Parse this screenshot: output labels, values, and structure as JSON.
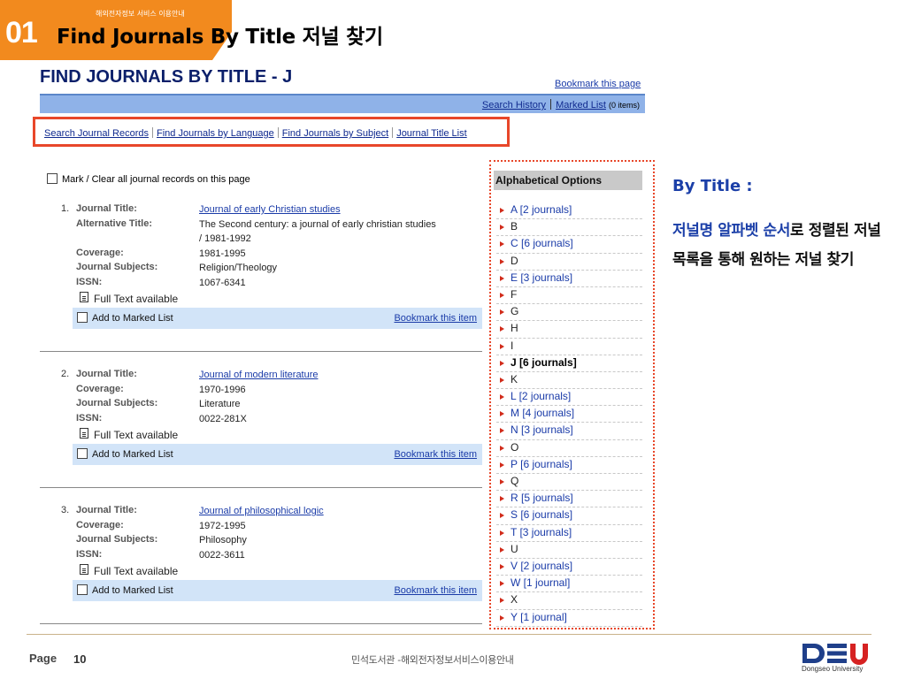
{
  "slide": {
    "section_number": "01",
    "section_subtitle": "해외전자정보 서비스 이용안내",
    "title": "Find Journals By Title 저널 찾기"
  },
  "screen": {
    "heading": "FIND JOURNALS BY TITLE - J",
    "bookmark_page": "Bookmark this page",
    "search_history": "Search History",
    "marked_list": "Marked List",
    "marked_count": "(0 items)",
    "nav_links": [
      "Search Journal Records",
      "Find Journals by Language",
      "Find Journals by Subject",
      "Journal Title List"
    ],
    "mark_all_label": "Mark / Clear all journal records on this page",
    "records": [
      {
        "num": "1.",
        "fields": [
          {
            "label": "Journal Title:",
            "value": "Journal of early Christian studies",
            "link": true
          },
          {
            "label": "Alternative Title:",
            "value": "The Second century: a journal of early christian studies / 1981-1992",
            "link": false
          },
          {
            "label": "Coverage:",
            "value": "1981-1995",
            "link": false
          },
          {
            "label": "Journal Subjects:",
            "value": "Religion/Theology",
            "link": false
          },
          {
            "label": "ISSN:",
            "value": "1067-6341",
            "link": false
          }
        ],
        "full_text": "Full Text available",
        "add_label": "Add to Marked List",
        "bookmark_item": "Bookmark this item"
      },
      {
        "num": "2.",
        "fields": [
          {
            "label": "Journal Title:",
            "value": "Journal of modern literature",
            "link": true
          },
          {
            "label": "Coverage:",
            "value": "1970-1996",
            "link": false
          },
          {
            "label": "Journal Subjects:",
            "value": "Literature",
            "link": false
          },
          {
            "label": "ISSN:",
            "value": "0022-281X",
            "link": false
          }
        ],
        "full_text": "Full Text available",
        "add_label": "Add to Marked List",
        "bookmark_item": "Bookmark this item"
      },
      {
        "num": "3.",
        "fields": [
          {
            "label": "Journal Title:",
            "value": "Journal of philosophical logic",
            "link": true
          },
          {
            "label": "Coverage:",
            "value": "1972-1995",
            "link": false
          },
          {
            "label": "Journal Subjects:",
            "value": "Philosophy",
            "link": false
          },
          {
            "label": "ISSN:",
            "value": "0022-3611",
            "link": false
          }
        ],
        "full_text": "Full Text available",
        "add_label": "Add to Marked List",
        "bookmark_item": "Bookmark this item"
      }
    ],
    "alpha_heading": "Alphabetical Options",
    "alpha_options": [
      {
        "text": "A [2 journals]",
        "state": "has"
      },
      {
        "text": "B",
        "state": "none"
      },
      {
        "text": "C [6 journals]",
        "state": "has"
      },
      {
        "text": "D",
        "state": "none"
      },
      {
        "text": "E [3 journals]",
        "state": "has"
      },
      {
        "text": "F",
        "state": "none"
      },
      {
        "text": "G",
        "state": "none"
      },
      {
        "text": "H",
        "state": "none"
      },
      {
        "text": "I",
        "state": "none"
      },
      {
        "text": "J [6 journals]",
        "state": "cur"
      },
      {
        "text": "K",
        "state": "none"
      },
      {
        "text": "L [2 journals]",
        "state": "has"
      },
      {
        "text": "M [4 journals]",
        "state": "has"
      },
      {
        "text": "N [3 journals]",
        "state": "has"
      },
      {
        "text": "O",
        "state": "none"
      },
      {
        "text": "P [6 journals]",
        "state": "has"
      },
      {
        "text": "Q",
        "state": "none"
      },
      {
        "text": "R [5 journals]",
        "state": "has"
      },
      {
        "text": "S [6 journals]",
        "state": "has"
      },
      {
        "text": "T [3 journals]",
        "state": "has"
      },
      {
        "text": "U",
        "state": "none"
      },
      {
        "text": "V [2 journals]",
        "state": "has"
      },
      {
        "text": "W [1 journal]",
        "state": "has"
      },
      {
        "text": "X",
        "state": "none"
      },
      {
        "text": "Y [1 journal]",
        "state": "has"
      }
    ]
  },
  "description": {
    "title": "By Title :",
    "highlight": "저널명 알파벳 순서",
    "rest": "로 정렬된 저널 목록을 통해 원하는 저널 찾기"
  },
  "footer": {
    "page_label": "Page",
    "page_number": "10",
    "center_text": "민석도서관 -해외전자정보서비스이용안내",
    "logo_text": "Dongseo University"
  },
  "colors": {
    "accent_orange": "#f28a1e",
    "highlight_red": "#e8472a",
    "link_blue": "#1a3ba8",
    "bar_blue": "#8fb2e8"
  }
}
